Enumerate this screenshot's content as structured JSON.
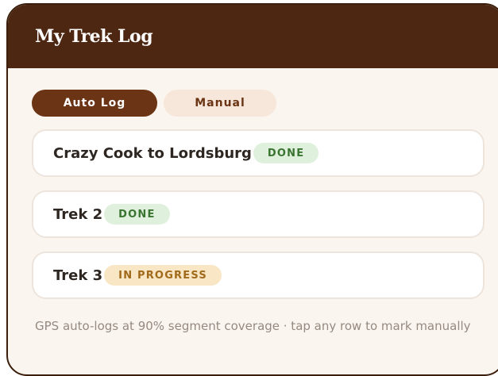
{
  "header": {
    "title": "My Trek Log"
  },
  "tabs": [
    {
      "label": "Auto Log",
      "active": true
    },
    {
      "label": "Manual",
      "active": false
    }
  ],
  "treks": [
    {
      "name": "Crazy Cook to Lordsburg",
      "status": "DONE"
    },
    {
      "name": "Trek 2",
      "status": "DONE"
    },
    {
      "name": "Trek 3",
      "status": "IN PROGRESS"
    }
  ],
  "footer": {
    "note": "GPS auto-logs at 90% segment coverage · tap any row to mark manually"
  },
  "colors": {
    "header_bg": "#4d2712",
    "accent": "#6b3414",
    "done_bg": "#dff0dc",
    "done_text": "#3a7431",
    "progress_bg": "#f8e6c4",
    "progress_text": "#a1691a"
  }
}
